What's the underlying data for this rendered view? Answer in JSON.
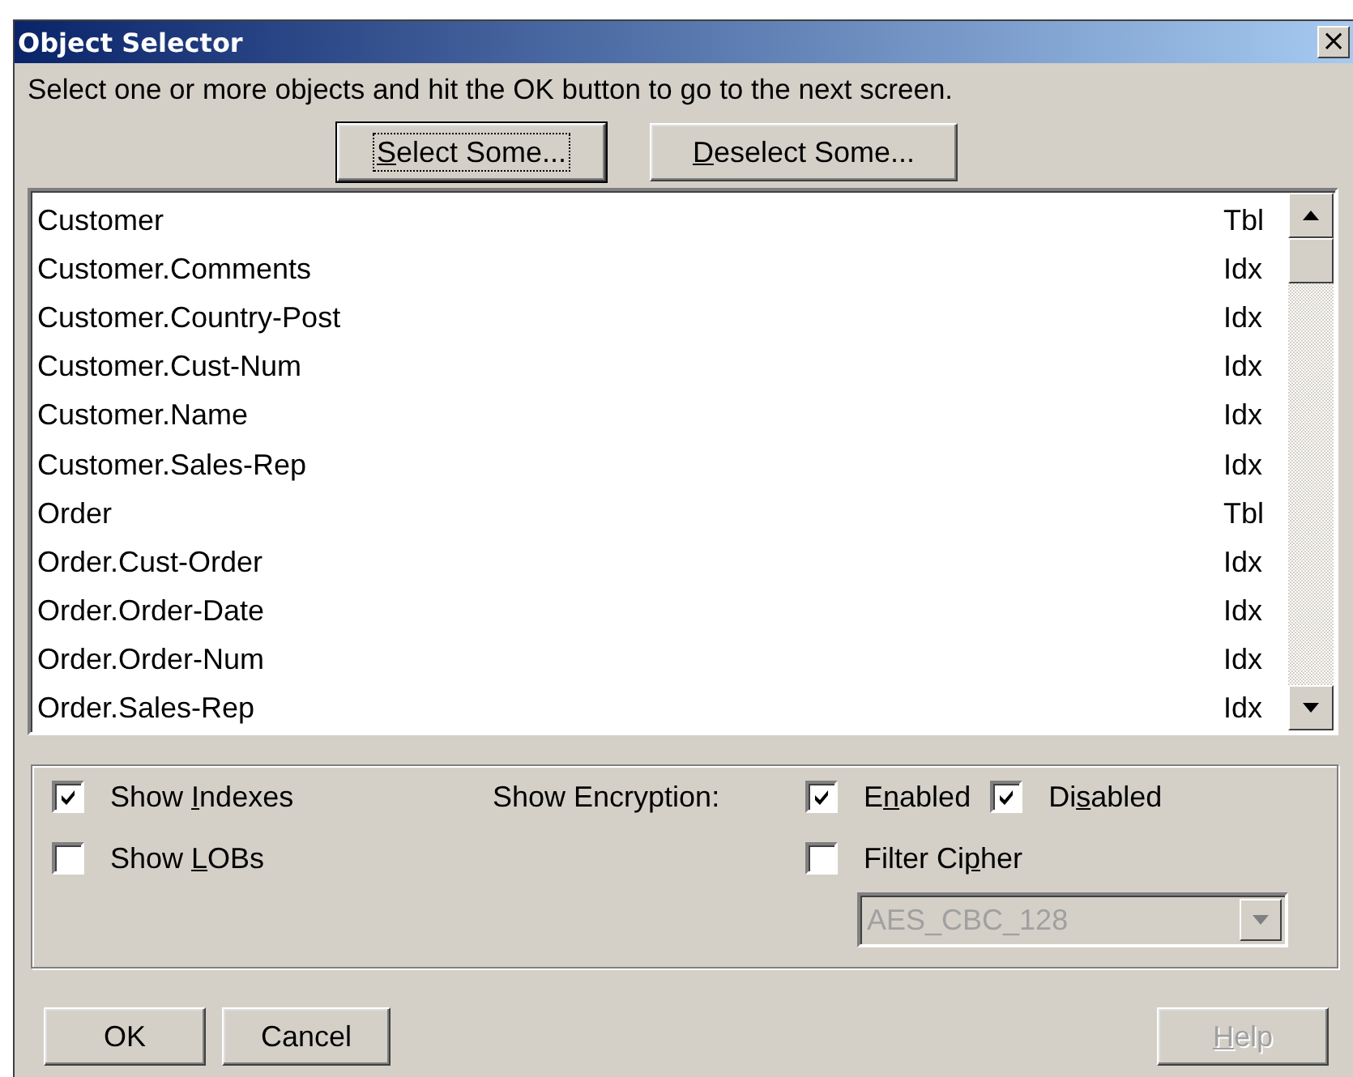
{
  "window": {
    "title": "Object Selector",
    "close": "×"
  },
  "instruction": "Select one or more objects and hit the OK button to go to the next screen.",
  "top_buttons": [
    {
      "key": "S",
      "rest": "elect Some...",
      "focused": true
    },
    {
      "key": "D",
      "rest": "eselect Some...",
      "focused": false
    }
  ],
  "objects": [
    {
      "name": "Customer",
      "type": "Tbl"
    },
    {
      "name": "Customer.Comments",
      "type": "Idx"
    },
    {
      "name": "Customer.Country-Post",
      "type": "Idx"
    },
    {
      "name": "Customer.Cust-Num",
      "type": "Idx"
    },
    {
      "name": "Customer.Name",
      "type": "Idx"
    },
    {
      "name": "Customer.Sales-Rep",
      "type": "Idx"
    },
    {
      "name": "Order",
      "type": "Tbl"
    },
    {
      "name": "Order.Cust-Order",
      "type": "Idx"
    },
    {
      "name": "Order.Order-Date",
      "type": "Idx"
    },
    {
      "name": "Order.Order-Num",
      "type": "Idx"
    },
    {
      "name": "Order.Sales-Rep",
      "type": "Idx"
    }
  ],
  "show_indexes": {
    "lead": "Show ",
    "key": "I",
    "rest": "ndexes",
    "checked": true
  },
  "show_lobs": {
    "lead": "Show ",
    "key": "L",
    "rest": "OBs",
    "checked": false
  },
  "encryption": {
    "label": "Show Encryption:",
    "enabled": {
      "lead": "E",
      "key": "n",
      "rest": "abled",
      "checked": true
    },
    "disabled": {
      "lead": "Di",
      "key": "s",
      "rest": "abled",
      "checked": true
    },
    "filter_cipher": {
      "lead": "Filter Ci",
      "key": "p",
      "rest": "her",
      "checked": false
    },
    "cipher": {
      "value": "AES_CBC_128",
      "disabled": true
    }
  },
  "bottom_buttons": [
    {
      "rest": "OK",
      "disabled": false
    },
    {
      "rest": "Cancel",
      "disabled": false
    },
    {
      "key": "H",
      "rest": "elp",
      "disabled": true
    }
  ]
}
